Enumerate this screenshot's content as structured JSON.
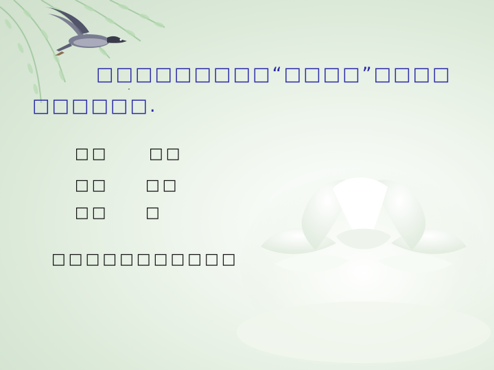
{
  "slide": {
    "intro_line_1": "□□□□□□□□□“□□□□”□□□□",
    "intro_line_2": "□□□□□□.",
    "words": [
      {
        "text": "□□"
      },
      {
        "text": "□□"
      },
      {
        "text": "□□"
      },
      {
        "text": "□□"
      },
      {
        "text": "□□"
      },
      {
        "text": "□"
      }
    ],
    "bottom_text": "□□□□□□□□□□□"
  },
  "colors": {
    "intro_text": "#2b2ba8",
    "body_text": "#111111",
    "background_light": "#ffffff",
    "background_green": "#d6e6d2"
  },
  "icons": {
    "decor_top_left": "willow-branches-icon",
    "bird": "flying-goose-icon",
    "flower": "white-lotus-icon"
  }
}
